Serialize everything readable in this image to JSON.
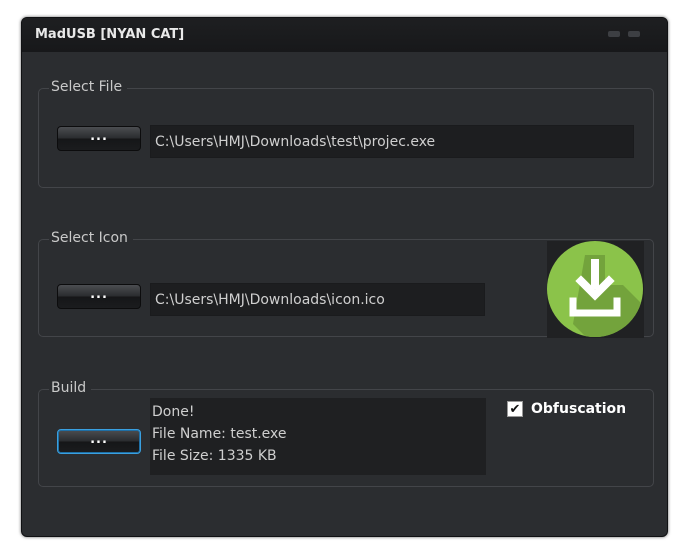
{
  "window": {
    "title": "MadUSB [NYAN CAT]"
  },
  "select_file": {
    "label": "Select File",
    "browse_label": "...",
    "path": "C:\\Users\\HMJ\\Downloads\\test\\projec.exe"
  },
  "select_icon": {
    "label": "Select Icon",
    "browse_label": "...",
    "path": "C:\\Users\\HMJ\\Downloads\\icon.ico",
    "preview_icon": "download-icon"
  },
  "build": {
    "label": "Build",
    "build_button_label": "...",
    "log": [
      "Done!",
      "File Name: test.exe",
      "File Size: 1335 KB"
    ],
    "obfuscation_label": "Obfuscation",
    "obfuscation_checked": true
  },
  "colors": {
    "background": "#2b2d30",
    "titlebar": "#17181a",
    "accent_focus": "#3aa0e0",
    "icon_green": "#8bc34a"
  }
}
